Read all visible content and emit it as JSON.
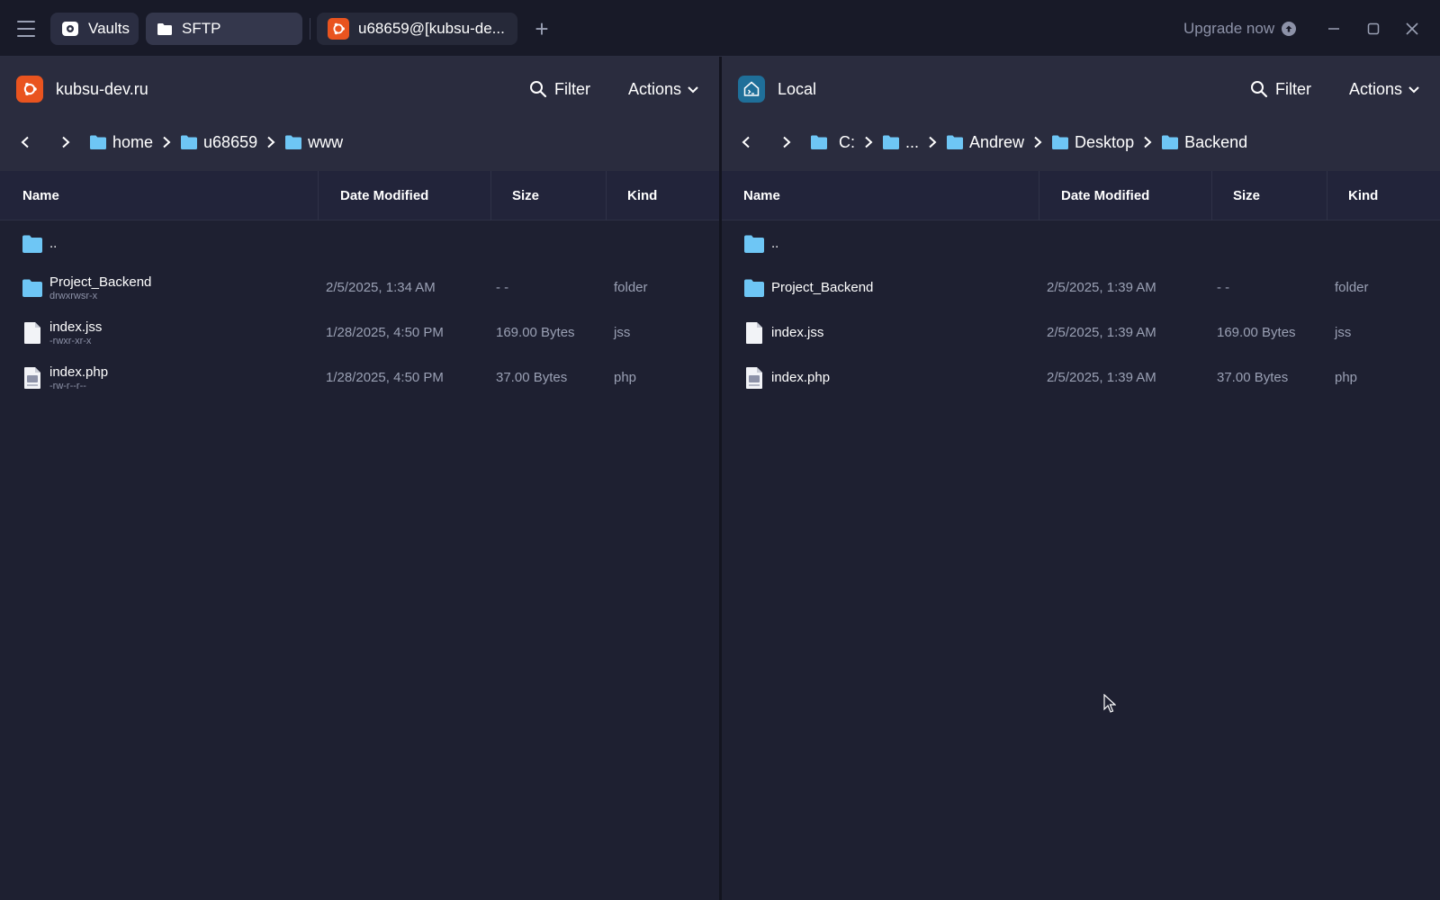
{
  "titlebar": {
    "tabs": [
      {
        "label": "Vaults"
      },
      {
        "label": "SFTP"
      },
      {
        "label": "u68659@[kubsu-de..."
      }
    ],
    "upgrade_label": "Upgrade now"
  },
  "left": {
    "host": "kubsu-dev.ru",
    "filter_label": "Filter",
    "actions_label": "Actions",
    "breadcrumb": [
      "home",
      "u68659",
      "www"
    ],
    "columns": {
      "name": "Name",
      "date": "Date Modified",
      "size": "Size",
      "kind": "Kind"
    },
    "rows": [
      {
        "name": "..",
        "perm": "",
        "date": "",
        "size": "",
        "kind": "",
        "icon": "folder-icon"
      },
      {
        "name": "Project_Backend",
        "perm": "drwxrwsr-x",
        "date": "2/5/2025, 1:34 AM",
        "size": "- -",
        "kind": "folder",
        "icon": "folder-icon"
      },
      {
        "name": "index.jss",
        "perm": "-rwxr-xr-x",
        "date": "1/28/2025, 4:50 PM",
        "size": "169.00 Bytes",
        "kind": "jss",
        "icon": "file-icon"
      },
      {
        "name": "index.php",
        "perm": "-rw-r--r--",
        "date": "1/28/2025, 4:50 PM",
        "size": "37.00 Bytes",
        "kind": "php",
        "icon": "php-file-icon"
      }
    ]
  },
  "right": {
    "host": "Local",
    "filter_label": "Filter",
    "actions_label": "Actions",
    "breadcrumb": [
      "C:",
      "...",
      "Andrew",
      "Desktop",
      "Backend"
    ],
    "columns": {
      "name": "Name",
      "date": "Date Modified",
      "size": "Size",
      "kind": "Kind"
    },
    "rows": [
      {
        "name": "..",
        "date": "",
        "size": "",
        "kind": "",
        "icon": "folder-icon"
      },
      {
        "name": "Project_Backend",
        "date": "2/5/2025, 1:39 AM",
        "size": "- -",
        "kind": "folder",
        "icon": "folder-icon"
      },
      {
        "name": "index.jss",
        "date": "2/5/2025, 1:39 AM",
        "size": "169.00 Bytes",
        "kind": "jss",
        "icon": "file-icon"
      },
      {
        "name": "index.php",
        "date": "2/5/2025, 1:39 AM",
        "size": "37.00 Bytes",
        "kind": "php",
        "icon": "php-file-icon"
      }
    ]
  },
  "colors": {
    "background": "#1e2031",
    "header": "#2a2c3e",
    "folder": "#6ec6f5",
    "ubuntu": "#e9541f",
    "local": "#1f6f99"
  }
}
